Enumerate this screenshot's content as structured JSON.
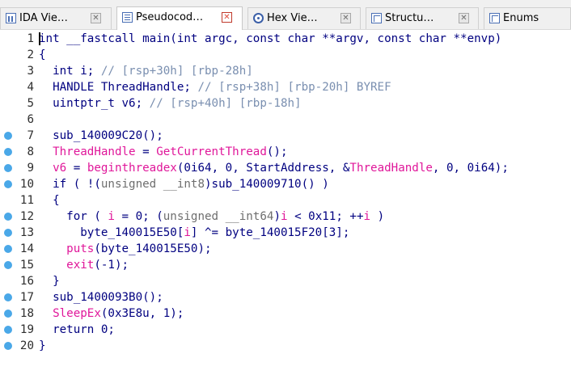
{
  "tabs": [
    {
      "label": "IDA Vie…",
      "icon": "ida-view-icon",
      "active": false
    },
    {
      "label": "Pseudocod…",
      "icon": "pseudocode-icon",
      "active": true
    },
    {
      "label": "Hex Vie…",
      "icon": "hex-view-icon",
      "active": false
    },
    {
      "label": "Structu…",
      "icon": "structures-icon",
      "active": false
    },
    {
      "label": "Enums",
      "icon": "enums-icon",
      "active": false
    }
  ],
  "tab_close_glyph": "✕",
  "colors": {
    "breakpoint_marker": "#4aa8e8",
    "import_function": "#e0179a",
    "comment": "#7a8fb0",
    "default_text": "#000080"
  },
  "lines": [
    {
      "n": "1",
      "marker": false,
      "tokens": [
        [
          "kw",
          "int __fastcall main(int argc, const char **argv, const char **envp)"
        ]
      ]
    },
    {
      "n": "2",
      "marker": false,
      "tokens": [
        [
          "pl",
          "{"
        ]
      ]
    },
    {
      "n": "3",
      "marker": false,
      "tokens": [
        [
          "pl",
          "  int i; "
        ],
        [
          "cm",
          "// [rsp+30h] [rbp-28h]"
        ]
      ]
    },
    {
      "n": "4",
      "marker": false,
      "tokens": [
        [
          "pl",
          "  HANDLE ThreadHandle; "
        ],
        [
          "cm",
          "// [rsp+38h] [rbp-20h] BYREF"
        ]
      ]
    },
    {
      "n": "5",
      "marker": false,
      "tokens": [
        [
          "pl",
          "  uintptr_t v6; "
        ],
        [
          "cm",
          "// [rsp+40h] [rbp-18h]"
        ]
      ]
    },
    {
      "n": "6",
      "marker": false,
      "tokens": [
        [
          "pl",
          ""
        ]
      ]
    },
    {
      "n": "7",
      "marker": true,
      "tokens": [
        [
          "fn",
          "  sub_140009C20();"
        ]
      ]
    },
    {
      "n": "8",
      "marker": true,
      "tokens": [
        [
          "pl",
          "  "
        ],
        [
          "im",
          "ThreadHandle"
        ],
        [
          "pl",
          " = "
        ],
        [
          "im",
          "GetCurrentThread"
        ],
        [
          "pl",
          "();"
        ]
      ]
    },
    {
      "n": "9",
      "marker": true,
      "tokens": [
        [
          "pl",
          "  "
        ],
        [
          "im",
          "v6"
        ],
        [
          "pl",
          " = "
        ],
        [
          "im",
          "beginthreadex"
        ],
        [
          "pl",
          "(0i64, 0, StartAddress, &"
        ],
        [
          "im",
          "ThreadHandle"
        ],
        [
          "pl",
          ", 0, 0i64);"
        ]
      ]
    },
    {
      "n": "10",
      "marker": true,
      "tokens": [
        [
          "pl",
          "  if ( !("
        ],
        [
          "ty",
          "unsigned __int8"
        ],
        [
          "pl",
          ")sub_140009710() )"
        ]
      ]
    },
    {
      "n": "11",
      "marker": false,
      "tokens": [
        [
          "pl",
          "  {"
        ]
      ]
    },
    {
      "n": "12",
      "marker": true,
      "tokens": [
        [
          "pl",
          "    for ( "
        ],
        [
          "im",
          "i"
        ],
        [
          "pl",
          " = 0; ("
        ],
        [
          "ty",
          "unsigned __int64"
        ],
        [
          "pl",
          ")"
        ],
        [
          "im",
          "i"
        ],
        [
          "pl",
          " < 0x11; ++"
        ],
        [
          "im",
          "i"
        ],
        [
          "pl",
          " )"
        ]
      ]
    },
    {
      "n": "13",
      "marker": true,
      "tokens": [
        [
          "pl",
          "      byte_140015E50["
        ],
        [
          "im",
          "i"
        ],
        [
          "pl",
          "] ^= byte_140015F20[3];"
        ]
      ]
    },
    {
      "n": "14",
      "marker": true,
      "tokens": [
        [
          "pl",
          "    "
        ],
        [
          "im",
          "puts"
        ],
        [
          "pl",
          "(byte_140015E50);"
        ]
      ]
    },
    {
      "n": "15",
      "marker": true,
      "tokens": [
        [
          "pl",
          "    "
        ],
        [
          "im",
          "exit"
        ],
        [
          "pl",
          "(-1);"
        ]
      ]
    },
    {
      "n": "16",
      "marker": false,
      "tokens": [
        [
          "pl",
          "  }"
        ]
      ]
    },
    {
      "n": "17",
      "marker": true,
      "tokens": [
        [
          "pl",
          "  sub_1400093B0();"
        ]
      ]
    },
    {
      "n": "18",
      "marker": true,
      "tokens": [
        [
          "pl",
          "  "
        ],
        [
          "im",
          "SleepEx"
        ],
        [
          "pl",
          "(0x3E8u, 1);"
        ]
      ]
    },
    {
      "n": "19",
      "marker": true,
      "tokens": [
        [
          "pl",
          "  return 0;"
        ]
      ]
    },
    {
      "n": "20",
      "marker": true,
      "tokens": [
        [
          "pl",
          "}"
        ]
      ]
    }
  ]
}
